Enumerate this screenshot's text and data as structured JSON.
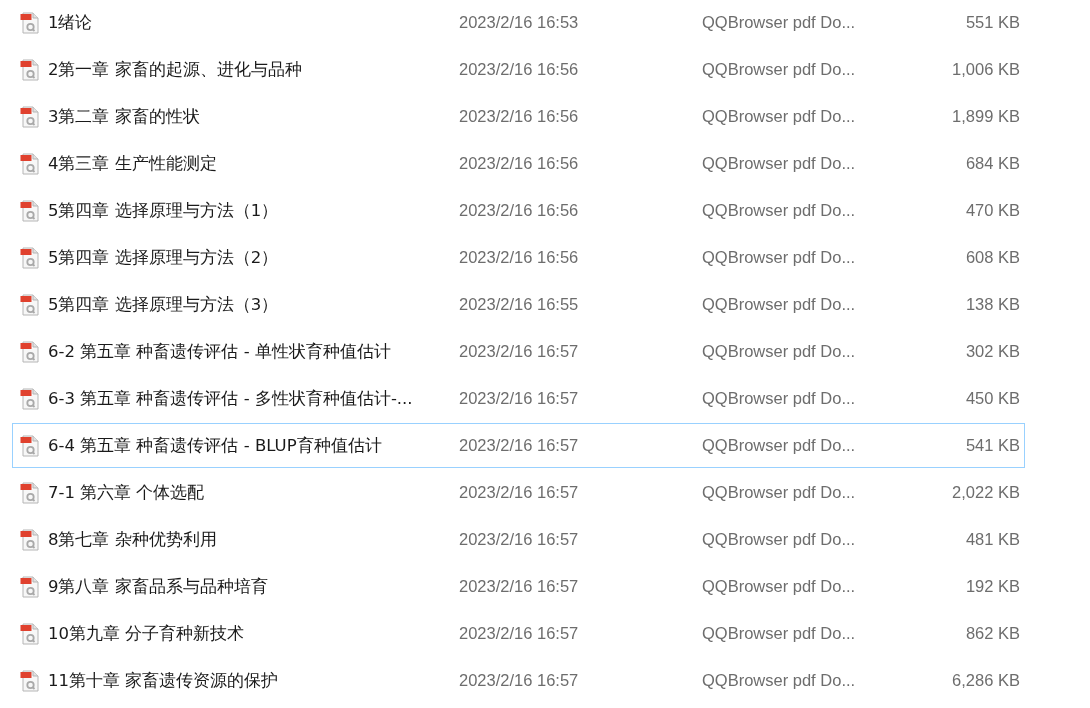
{
  "files": [
    {
      "name": "1绪论",
      "modified": "2023/2/16 16:53",
      "type": "QQBrowser pdf Do...",
      "size": "551 KB",
      "focused": false
    },
    {
      "name": "2第一章 家畜的起源、进化与品种",
      "modified": "2023/2/16 16:56",
      "type": "QQBrowser pdf Do...",
      "size": "1,006 KB",
      "focused": false
    },
    {
      "name": "3第二章 家畜的性状",
      "modified": "2023/2/16 16:56",
      "type": "QQBrowser pdf Do...",
      "size": "1,899 KB",
      "focused": false
    },
    {
      "name": "4第三章 生产性能测定",
      "modified": "2023/2/16 16:56",
      "type": "QQBrowser pdf Do...",
      "size": "684 KB",
      "focused": false
    },
    {
      "name": "5第四章 选择原理与方法（1）",
      "modified": "2023/2/16 16:56",
      "type": "QQBrowser pdf Do...",
      "size": "470 KB",
      "focused": false
    },
    {
      "name": "5第四章 选择原理与方法（2）",
      "modified": "2023/2/16 16:56",
      "type": "QQBrowser pdf Do...",
      "size": "608 KB",
      "focused": false
    },
    {
      "name": "5第四章 选择原理与方法（3）",
      "modified": "2023/2/16 16:55",
      "type": "QQBrowser pdf Do...",
      "size": "138 KB",
      "focused": false
    },
    {
      "name": "6-2 第五章 种畜遗传评估 - 单性状育种值估计",
      "modified": "2023/2/16 16:57",
      "type": "QQBrowser pdf Do...",
      "size": "302 KB",
      "focused": false
    },
    {
      "name": "6-3 第五章 种畜遗传评估 - 多性状育种值估计-...",
      "modified": "2023/2/16 16:57",
      "type": "QQBrowser pdf Do...",
      "size": "450 KB",
      "focused": false
    },
    {
      "name": "6-4 第五章 种畜遗传评估 - BLUP育种值估计",
      "modified": "2023/2/16 16:57",
      "type": "QQBrowser pdf Do...",
      "size": "541 KB",
      "focused": true
    },
    {
      "name": "7-1 第六章 个体选配",
      "modified": "2023/2/16 16:57",
      "type": "QQBrowser pdf Do...",
      "size": "2,022 KB",
      "focused": false
    },
    {
      "name": "8第七章 杂种优势利用",
      "modified": "2023/2/16 16:57",
      "type": "QQBrowser pdf Do...",
      "size": "481 KB",
      "focused": false
    },
    {
      "name": "9第八章 家畜品系与品种培育",
      "modified": "2023/2/16 16:57",
      "type": "QQBrowser pdf Do...",
      "size": "192 KB",
      "focused": false
    },
    {
      "name": "10第九章 分子育种新技术",
      "modified": "2023/2/16 16:57",
      "type": "QQBrowser pdf Do...",
      "size": "862 KB",
      "focused": false
    },
    {
      "name": "11第十章 家畜遗传资源的保护",
      "modified": "2023/2/16 16:57",
      "type": "QQBrowser pdf Do...",
      "size": "6,286 KB",
      "focused": false
    }
  ]
}
